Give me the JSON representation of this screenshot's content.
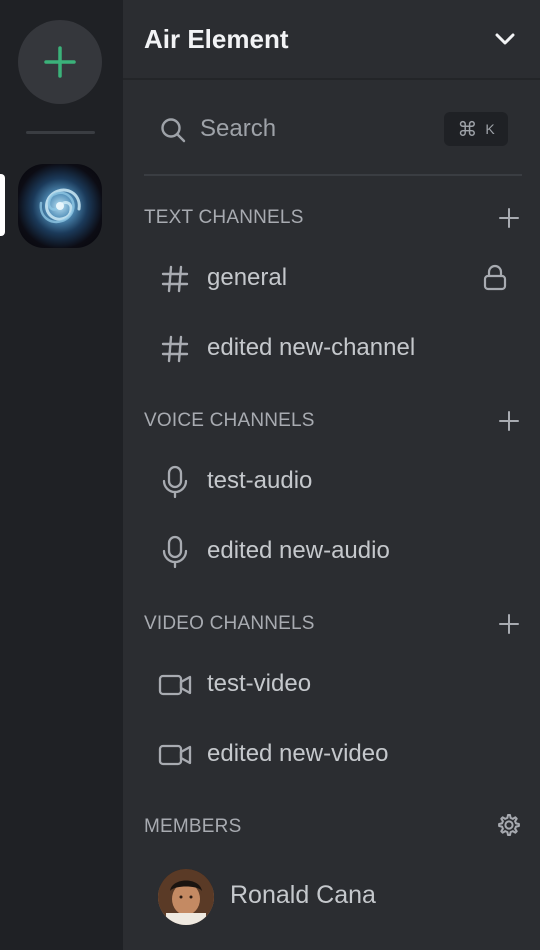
{
  "server": {
    "name": "Air Element"
  },
  "rail": {
    "add_icon": "plus-icon",
    "accent": "#3bb27a"
  },
  "search": {
    "label": "Search",
    "shortcut_symbol": "⌘",
    "shortcut_key": "K"
  },
  "sections": {
    "text": {
      "title": "TEXT CHANNELS",
      "channels": [
        {
          "name": "general",
          "icon": "hash-icon",
          "locked": true
        },
        {
          "name": "edited new-channel",
          "icon": "hash-icon",
          "locked": false
        }
      ]
    },
    "voice": {
      "title": "VOICE CHANNELS",
      "channels": [
        {
          "name": "test-audio",
          "icon": "microphone-icon"
        },
        {
          "name": "edited new-audio",
          "icon": "microphone-icon"
        }
      ]
    },
    "video": {
      "title": "VIDEO CHANNELS",
      "channels": [
        {
          "name": "test-video",
          "icon": "video-camera-icon"
        },
        {
          "name": "edited new-video",
          "icon": "video-camera-icon"
        }
      ]
    }
  },
  "members": {
    "title": "MEMBERS",
    "list": [
      {
        "name": "Ronald Cana"
      }
    ]
  }
}
